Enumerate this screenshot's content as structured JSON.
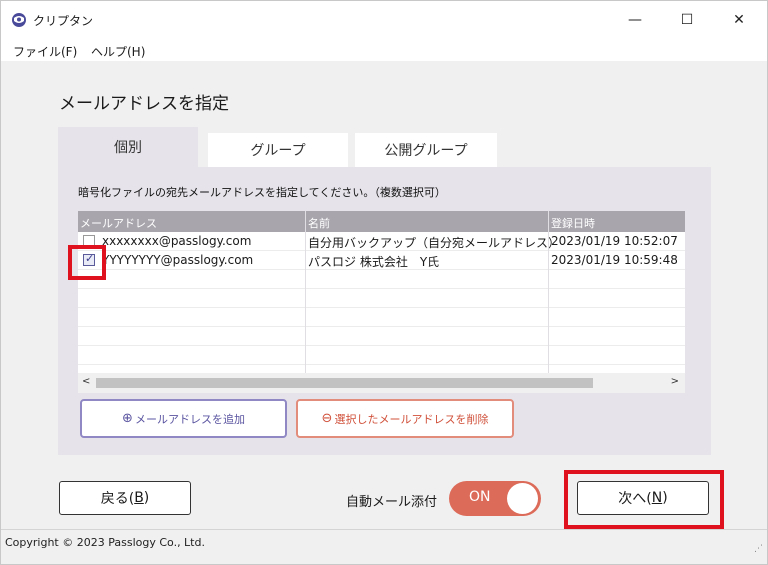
{
  "window": {
    "title": "クリプタン",
    "controls": {
      "minimize": "—",
      "maximize": "☐",
      "close": "✕"
    }
  },
  "menu": [
    {
      "label": "ファイル(F)"
    },
    {
      "label": "ヘルプ(H)"
    }
  ],
  "page_title": "メールアドレスを指定",
  "tabs": [
    {
      "label": "個別",
      "active": true
    },
    {
      "label": "グループ",
      "active": false
    },
    {
      "label": "公開グループ",
      "active": false
    }
  ],
  "instruction": "暗号化ファイルの宛先メールアドレスを指定してください。（複数選択可）",
  "table": {
    "columns": [
      "メールアドレス",
      "名前",
      "登録日時"
    ],
    "rows": [
      {
        "email": "xxxxxxxx@passlogy.com",
        "name": "自分用バックアップ（自分宛メールアドレス）",
        "date": "2023/01/19 10:52:07",
        "checked": false
      },
      {
        "email": "YYYYYYYY@passlogy.com",
        "name": "パスロジ 株式会社　Y氏",
        "date": "2023/01/19 10:59:48",
        "checked": true
      }
    ]
  },
  "scrollbar": {
    "left": "<",
    "right": ">"
  },
  "buttons": {
    "add_icon": "⊕",
    "add": "メールアドレスを追加",
    "delete_icon": "⊖",
    "delete": "選択したメールアドレスを削除",
    "back_text": "戻る(",
    "back_key": "B",
    "back_close": ")",
    "next_text": "次へ(",
    "next_key": "N",
    "next_close": ")"
  },
  "auto_attach": {
    "label": "自動メール添付",
    "state": "ON"
  },
  "footer": {
    "copyright": "Copyright © 2023 Passlogy Co., Ltd.",
    "grip": "⋰"
  },
  "colors": {
    "toggle_on": "#dd6b59",
    "add_border": "#8f88c4",
    "delete_border": "#e28c7c",
    "highlight": "#e0111f",
    "header_bg": "#a9a5ad",
    "panel_bg": "#e6e3ea"
  }
}
